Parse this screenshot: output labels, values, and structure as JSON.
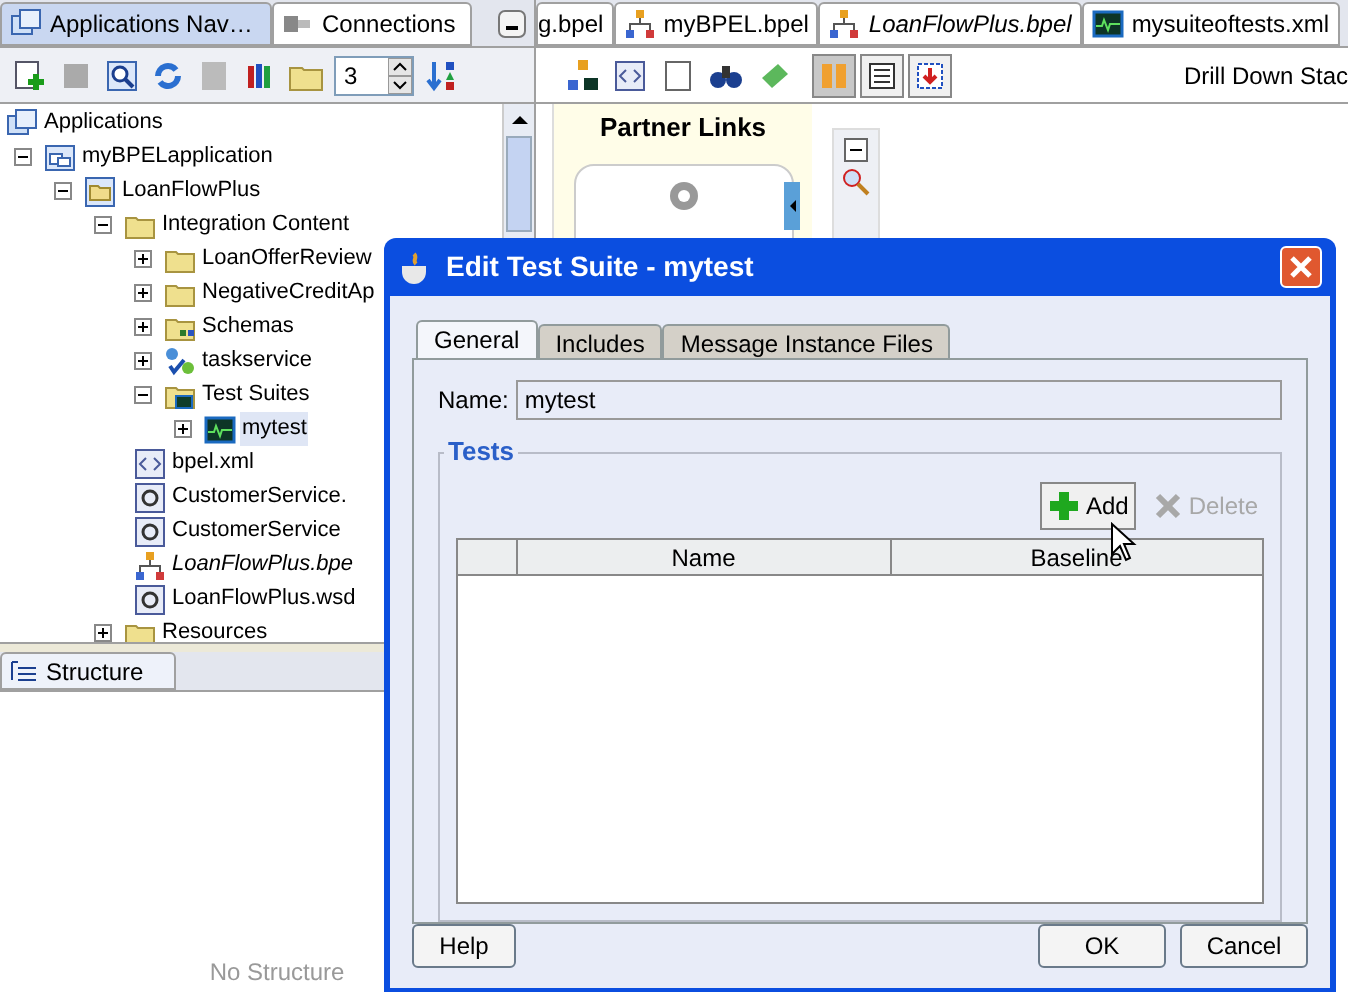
{
  "left_tabs": [
    {
      "label": "Applications Nav…",
      "selected": true
    },
    {
      "label": "Connections",
      "selected": false
    }
  ],
  "level_spinner": {
    "value": "3"
  },
  "tree": [
    {
      "label": "Applications",
      "kind": "apps",
      "children": [
        {
          "label": "myBPELapplication",
          "kind": "app",
          "expanded": true,
          "children": [
            {
              "label": "LoanFlowPlus",
              "kind": "project",
              "expanded": true,
              "children": [
                {
                  "label": "Integration Content",
                  "kind": "folder",
                  "expanded": true,
                  "children": [
                    {
                      "label": "LoanOfferReview",
                      "kind": "folder",
                      "expanded": false
                    },
                    {
                      "label": "NegativeCreditAp",
                      "kind": "folder",
                      "expanded": false
                    },
                    {
                      "label": "Schemas",
                      "kind": "schema",
                      "expanded": false
                    },
                    {
                      "label": "taskservice",
                      "kind": "service",
                      "expanded": false
                    },
                    {
                      "label": "Test Suites",
                      "kind": "testfolder",
                      "expanded": true,
                      "children": [
                        {
                          "label": "mytest",
                          "kind": "test",
                          "expanded": false,
                          "selected": true
                        }
                      ]
                    },
                    {
                      "label": "bpel.xml",
                      "kind": "xml",
                      "italic": false
                    },
                    {
                      "label": "CustomerService.",
                      "kind": "wsdl",
                      "italic": false
                    },
                    {
                      "label": "CustomerService",
                      "kind": "wsdl",
                      "italic": false
                    },
                    {
                      "label": "LoanFlowPlus.bpe",
                      "kind": "bpel",
                      "italic": true
                    },
                    {
                      "label": "LoanFlowPlus.wsd",
                      "kind": "wsdl",
                      "italic": false
                    }
                  ]
                },
                {
                  "label": "Resources",
                  "kind": "folder",
                  "expanded": false
                }
              ]
            }
          ]
        }
      ]
    }
  ],
  "structure": {
    "tab": "Structure",
    "empty_text": "No Structure"
  },
  "editor_tabs": [
    {
      "label": "g.bpel",
      "italic": false
    },
    {
      "label": "myBPEL.bpel",
      "italic": false
    },
    {
      "label": "LoanFlowPlus.bpel",
      "italic": true
    },
    {
      "label": "mysuiteoftests.xml",
      "italic": false
    }
  ],
  "editor_toolbar": {
    "toggles": [
      {
        "selected": true
      },
      {
        "selected": false
      },
      {
        "selected": false
      }
    ],
    "drill_down": "Drill Down Stac"
  },
  "canvas": {
    "heading": "Partner Links"
  },
  "dialog": {
    "title": "Edit Test Suite - mytest",
    "tabs": [
      {
        "label": "General",
        "selected": true
      },
      {
        "label": "Includes",
        "selected": false
      },
      {
        "label": "Message Instance Files",
        "selected": false
      }
    ],
    "name_label": "Name:",
    "name_value": "mytest",
    "group_title": "Tests",
    "actions": [
      {
        "label": "Add",
        "kind": "add",
        "disabled": false
      },
      {
        "label": "Delete",
        "kind": "delete",
        "disabled": true
      }
    ],
    "columns": [
      "Name",
      "Baseline"
    ],
    "buttons": [
      {
        "label": "Help",
        "kind": "help"
      },
      {
        "label": "OK",
        "kind": "ok"
      },
      {
        "label": "Cancel",
        "kind": "cancel"
      }
    ]
  }
}
